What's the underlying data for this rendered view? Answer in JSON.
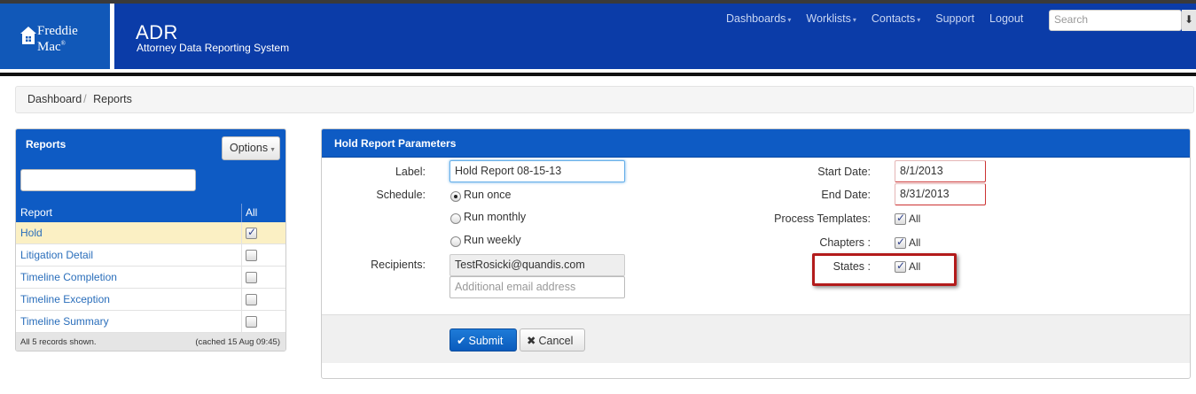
{
  "header": {
    "logo_line1": "Freddie",
    "logo_line2": "Mac",
    "logo_mark": "®",
    "app_title": "ADR",
    "app_subtitle": "Attorney Data Reporting System",
    "nav": [
      "Dashboards",
      "Worklists",
      "Contacts",
      "Support",
      "Logout"
    ],
    "search_placeholder": "Search",
    "search_icon": "arrow-down-icon"
  },
  "breadcrumb": {
    "items": [
      "Dashboard",
      "Reports"
    ],
    "separator": "/"
  },
  "reports_panel": {
    "title": "Reports",
    "options_label": "Options",
    "col_report": "Report",
    "col_all": "All",
    "rows": [
      {
        "name": "Hold",
        "checked": true
      },
      {
        "name": "Litigation Detail",
        "checked": false
      },
      {
        "name": "Timeline Completion",
        "checked": false
      },
      {
        "name": "Timeline Exception",
        "checked": false
      },
      {
        "name": "Timeline Summary",
        "checked": false
      }
    ],
    "footer_left": "All 5 records shown.",
    "footer_right": "(cached 15 Aug 09:45)"
  },
  "params": {
    "title": "Hold Report Parameters",
    "label_label": "Label:",
    "label_value": "Hold Report 08-15-13",
    "schedule_label": "Schedule:",
    "schedule_options": [
      "Run once",
      "Run monthly",
      "Run weekly"
    ],
    "schedule_selected": "Run once",
    "recipients_label": "Recipients:",
    "recipient_value": "TestRosicki@quandis.com",
    "additional_placeholder": "Additional email address",
    "start_date_label": "Start Date:",
    "start_date": "8/1/2013",
    "end_date_label": "End Date:",
    "end_date": "8/31/2013",
    "process_templates_label": "Process Templates:",
    "chapters_label": "Chapters :",
    "states_label": "States :",
    "all_text": "All"
  },
  "actions": {
    "submit": "Submit",
    "cancel": "Cancel"
  },
  "colors": {
    "header_blue": "#0b3ca8",
    "panel_blue": "#0e5bc4",
    "highlight_red": "#b31b1b",
    "selected_row": "#fbf0c4"
  }
}
